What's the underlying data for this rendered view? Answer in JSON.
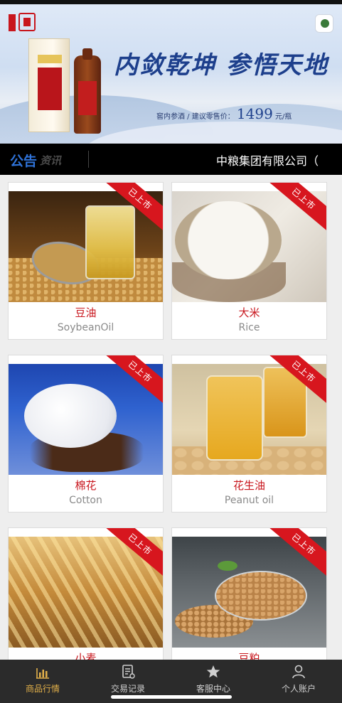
{
  "banner": {
    "slogan": "内敛乾坤  参悟天地",
    "price_prefix": "窖内参酒 / 建议零售价：",
    "price_value": "1499",
    "price_unit": "元/瓶"
  },
  "notice": {
    "title": "公告",
    "subtitle": "资讯",
    "marquee": "中粮集团有限公司（"
  },
  "products": [
    {
      "cn": "豆油",
      "en": "SoybeanOil",
      "badge": "已上市"
    },
    {
      "cn": "大米",
      "en": "Rice",
      "badge": "已上市"
    },
    {
      "cn": "棉花",
      "en": "Cotton",
      "badge": "已上市"
    },
    {
      "cn": "花生油",
      "en": "Peanut oil",
      "badge": "已上市"
    },
    {
      "cn": "小麦",
      "en": "",
      "badge": "已上市"
    },
    {
      "cn": "豆粕",
      "en": "",
      "badge": "已上市"
    }
  ],
  "nav": [
    {
      "label": "商品行情",
      "icon": "chart-icon",
      "active": true
    },
    {
      "label": "交易记录",
      "icon": "document-icon",
      "active": false
    },
    {
      "label": "客服中心",
      "icon": "star-icon",
      "active": false
    },
    {
      "label": "个人账户",
      "icon": "user-icon",
      "active": false
    }
  ],
  "colors": {
    "accent_red": "#c8161d",
    "nav_active": "#e2b04a",
    "notice_blue": "#2f73d9"
  }
}
